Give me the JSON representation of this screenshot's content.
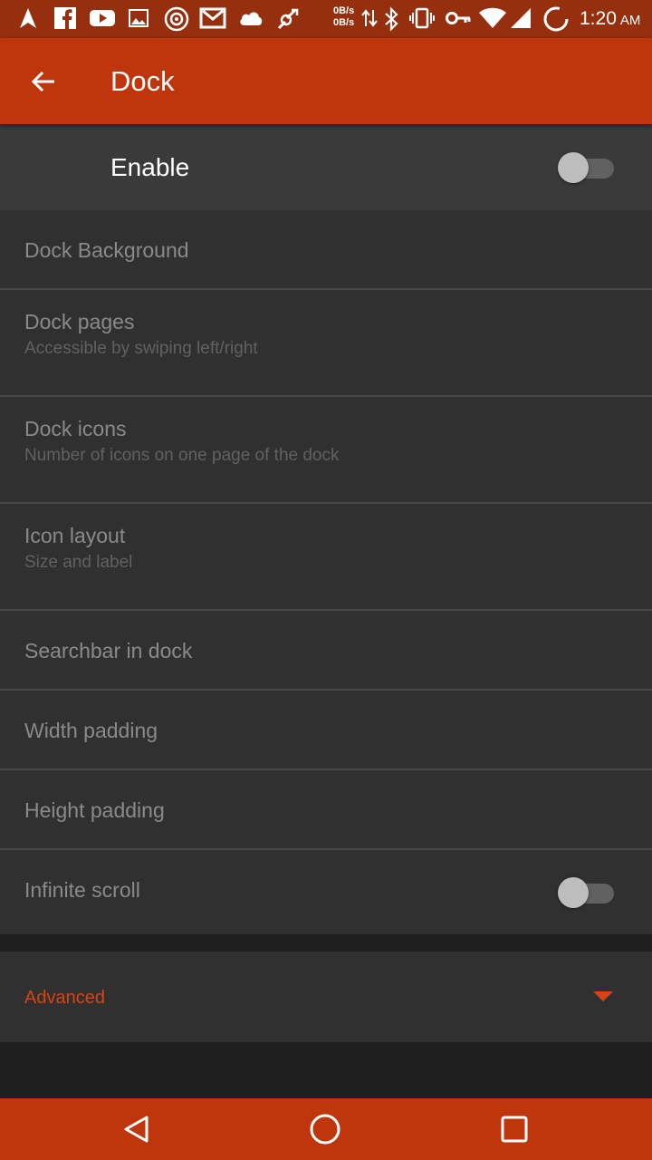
{
  "status_bar": {
    "net_up": "0B/s",
    "net_down": "0B/s",
    "time": "1:20",
    "ampm": "AM",
    "icons": [
      "navigation-icon",
      "facebook-icon",
      "youtube-icon",
      "image-icon",
      "music-icon",
      "gmail-icon",
      "cloud-icon",
      "sync-icon",
      "data-arrows-icon",
      "bluetooth-icon",
      "vibrate-icon",
      "key-icon",
      "wifi-icon",
      "signal-icon",
      "battery-icon"
    ]
  },
  "appbar": {
    "title": "Dock",
    "back_icon": "arrow-back-icon"
  },
  "enable": {
    "label": "Enable",
    "on": false
  },
  "settings": {
    "items": [
      {
        "title": "Dock Background"
      },
      {
        "title": "Dock pages",
        "subtitle": "Accessible by swiping left/right"
      },
      {
        "title": "Dock icons",
        "subtitle": "Number of icons on one page of the dock"
      },
      {
        "title": "Icon layout",
        "subtitle": "Size and label"
      },
      {
        "title": "Searchbar in dock"
      },
      {
        "title": "Width padding"
      },
      {
        "title": "Height padding"
      },
      {
        "title": "Infinite scroll",
        "toggle": false
      }
    ]
  },
  "advanced": {
    "label": "Advanced",
    "icon": "triangle-down-icon"
  },
  "colors": {
    "primary": "#bf360c",
    "status_bar": "#962f0e",
    "accent": "#d84315",
    "background": "#303030"
  },
  "navbar": {
    "icons": [
      "back-triangle-icon",
      "home-circle-icon",
      "recents-square-icon"
    ]
  }
}
